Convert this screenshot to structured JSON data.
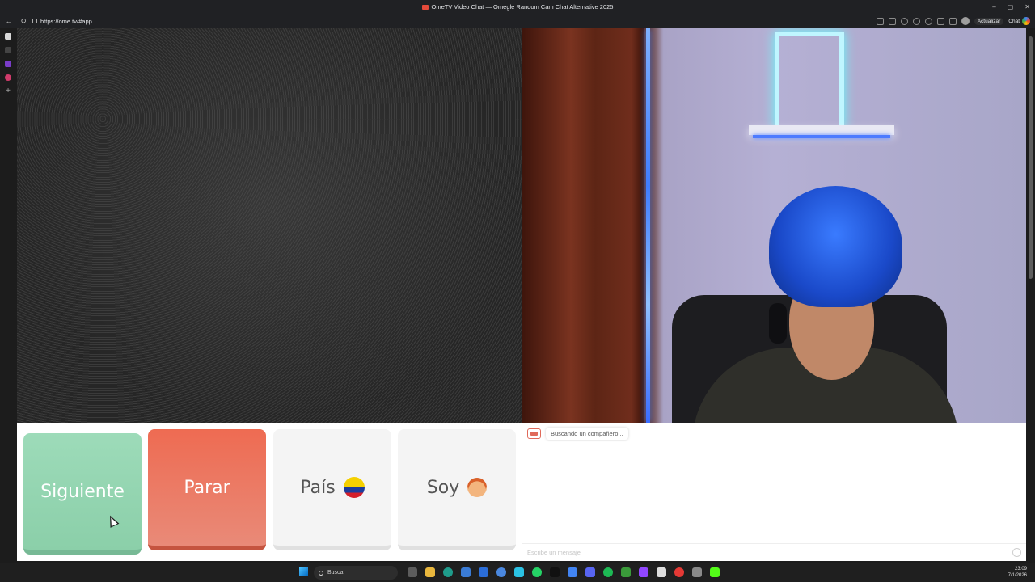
{
  "window": {
    "title": "OmeTV Video Chat — Omegle Random Cam Chat Alternative 2025",
    "controls": [
      "–",
      "▢",
      "✕"
    ]
  },
  "browser": {
    "url": "https://ome.tv/#app",
    "update_label": "Actualizar",
    "chat_label": "Chat"
  },
  "controls": {
    "next_label": "Siguiente",
    "stop_label": "Parar",
    "country_label": "País",
    "country_flag": "colombia-flag-icon",
    "soy_label": "Soy",
    "soy_icon": "boy-emoji-icon"
  },
  "chat": {
    "status_message": "Buscando un compañero...",
    "input_placeholder": "Escribe un mensaje"
  },
  "taskbar": {
    "search_label": "Buscar",
    "time": "23:09",
    "date": "7/1/2026"
  },
  "colors": {
    "next": "#9ddbb9",
    "stop": "#ee6b52",
    "neutral": "#f4f4f4"
  }
}
